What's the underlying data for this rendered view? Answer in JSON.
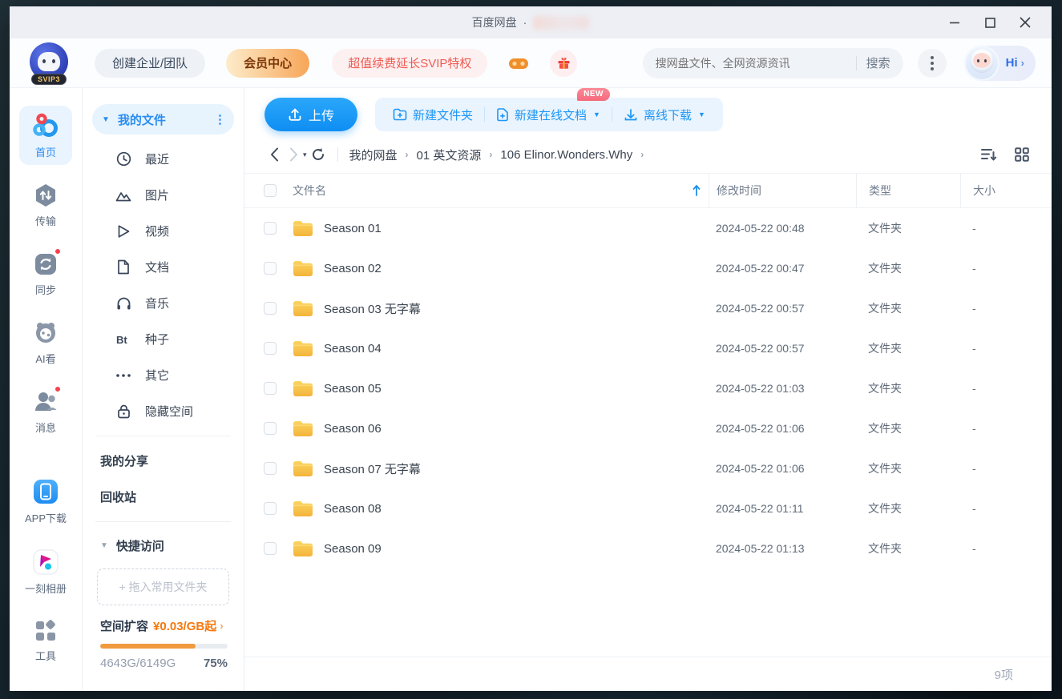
{
  "window": {
    "title": "百度网盘",
    "title_separator": "·"
  },
  "header": {
    "logo_badge": "SVIP3",
    "create_team": "创建企业/团队",
    "member_center": "会员中心",
    "svip_promo": "超值续费延长SVIP特权",
    "search_placeholder": "搜网盘文件、全网资源资讯",
    "search_button": "搜索",
    "greeting": "Hi",
    "greeting_chevron": "›"
  },
  "rail": {
    "items": [
      {
        "label": "首页"
      },
      {
        "label": "传输"
      },
      {
        "label": "同步"
      },
      {
        "label": "AI看"
      },
      {
        "label": "消息"
      }
    ],
    "bottom_items": [
      {
        "label": "APP下载"
      },
      {
        "label": "一刻相册"
      },
      {
        "label": "工具"
      }
    ]
  },
  "nav": {
    "my_files": "我的文件",
    "expand_triangle": "▼",
    "items": [
      "最近",
      "图片",
      "视频",
      "文档",
      "音乐",
      "种子",
      "其它",
      "隐藏空间"
    ],
    "links": [
      "我的分享",
      "回收站"
    ],
    "quick_access": "快捷访问",
    "drop_hint": "+ 拖入常用文件夹",
    "storage": {
      "label": "空间扩容",
      "price": "¥0.03/GB起",
      "chevron": "›",
      "usage": "4643G/6149G",
      "percent": "75%",
      "percent_value": 75
    }
  },
  "toolbar": {
    "upload": "上传",
    "new_folder": "新建文件夹",
    "new_doc": "新建在线文档",
    "new_badge": "NEW",
    "offline_download": "离线下载",
    "caret": "▼"
  },
  "breadcrumb": {
    "items": [
      "我的网盘",
      "01 英文资源",
      "106 Elinor.Wonders.Why"
    ],
    "separator": "›",
    "collapse_caret": "▾"
  },
  "table": {
    "headers": {
      "name": "文件名",
      "time": "修改时间",
      "type": "类型",
      "size": "大小"
    },
    "rows": [
      {
        "name": "Season 01",
        "time": "2024-05-22 00:48",
        "type": "文件夹",
        "size": "-"
      },
      {
        "name": "Season 02",
        "time": "2024-05-22 00:47",
        "type": "文件夹",
        "size": "-"
      },
      {
        "name": "Season 03 无字幕",
        "time": "2024-05-22 00:57",
        "type": "文件夹",
        "size": "-"
      },
      {
        "name": "Season 04",
        "time": "2024-05-22 00:57",
        "type": "文件夹",
        "size": "-"
      },
      {
        "name": "Season 05",
        "time": "2024-05-22 01:03",
        "type": "文件夹",
        "size": "-"
      },
      {
        "name": "Season 06",
        "time": "2024-05-22 01:06",
        "type": "文件夹",
        "size": "-"
      },
      {
        "name": "Season 07 无字幕",
        "time": "2024-05-22 01:06",
        "type": "文件夹",
        "size": "-"
      },
      {
        "name": "Season 08",
        "time": "2024-05-22 01:11",
        "type": "文件夹",
        "size": "-"
      },
      {
        "name": "Season 09",
        "time": "2024-05-22 01:13",
        "type": "文件夹",
        "size": "-"
      }
    ],
    "footer_count": "9项"
  },
  "colors": {
    "accent_blue": "#1d96f5",
    "accent_orange": "#f5790f",
    "folder_yellow": "#f7c64a",
    "badge_red": "#f5424e"
  }
}
